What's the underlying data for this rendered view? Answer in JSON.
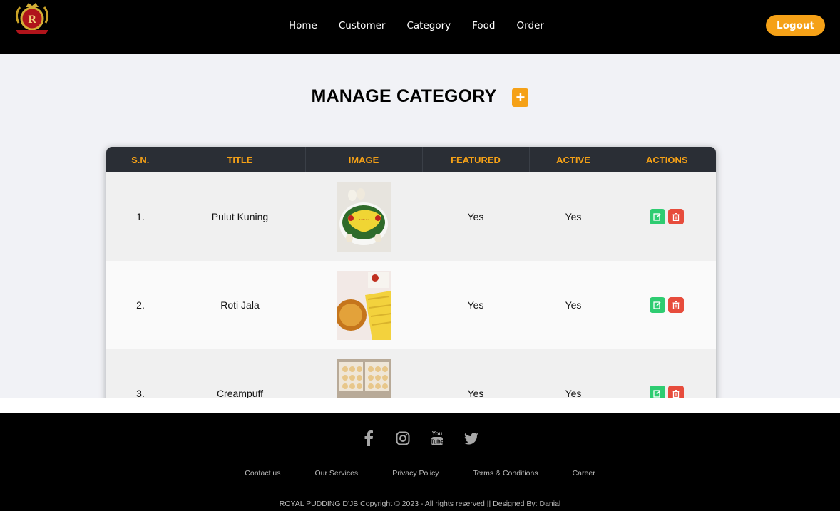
{
  "brand": {
    "logo_text": "ROYAL PUDDING"
  },
  "nav": {
    "items": [
      {
        "label": "Home"
      },
      {
        "label": "Customer"
      },
      {
        "label": "Category"
      },
      {
        "label": "Food"
      },
      {
        "label": "Order"
      }
    ],
    "logout_label": "Logout"
  },
  "main": {
    "title": "MANAGE CATEGORY",
    "add_icon": "plus-icon"
  },
  "table": {
    "headers": [
      "S.N.",
      "TITLE",
      "IMAGE",
      "FEATURED",
      "ACTIVE",
      "ACTIONS"
    ],
    "rows": [
      {
        "sn": "1.",
        "title": "Pulut Kuning",
        "featured": "Yes",
        "active": "Yes"
      },
      {
        "sn": "2.",
        "title": "Roti Jala",
        "featured": "Yes",
        "active": "Yes"
      },
      {
        "sn": "3.",
        "title": "Creampuff",
        "featured": "Yes",
        "active": "Yes"
      }
    ]
  },
  "footer": {
    "social": [
      "facebook-icon",
      "instagram-icon",
      "youtube-icon",
      "twitter-icon"
    ],
    "links": [
      "Contact us",
      "Our Services",
      "Privacy Policy",
      "Terms & Conditions",
      "Career"
    ],
    "copyright": "ROYAL PUDDING D'JB Copyright © 2023 - All rights reserved || Designed By: Danial"
  },
  "colors": {
    "accent": "#f5a117",
    "header_bg": "#000000",
    "table_header_bg": "#2a2e35",
    "edit": "#2ecc71",
    "delete": "#e74c3c"
  }
}
